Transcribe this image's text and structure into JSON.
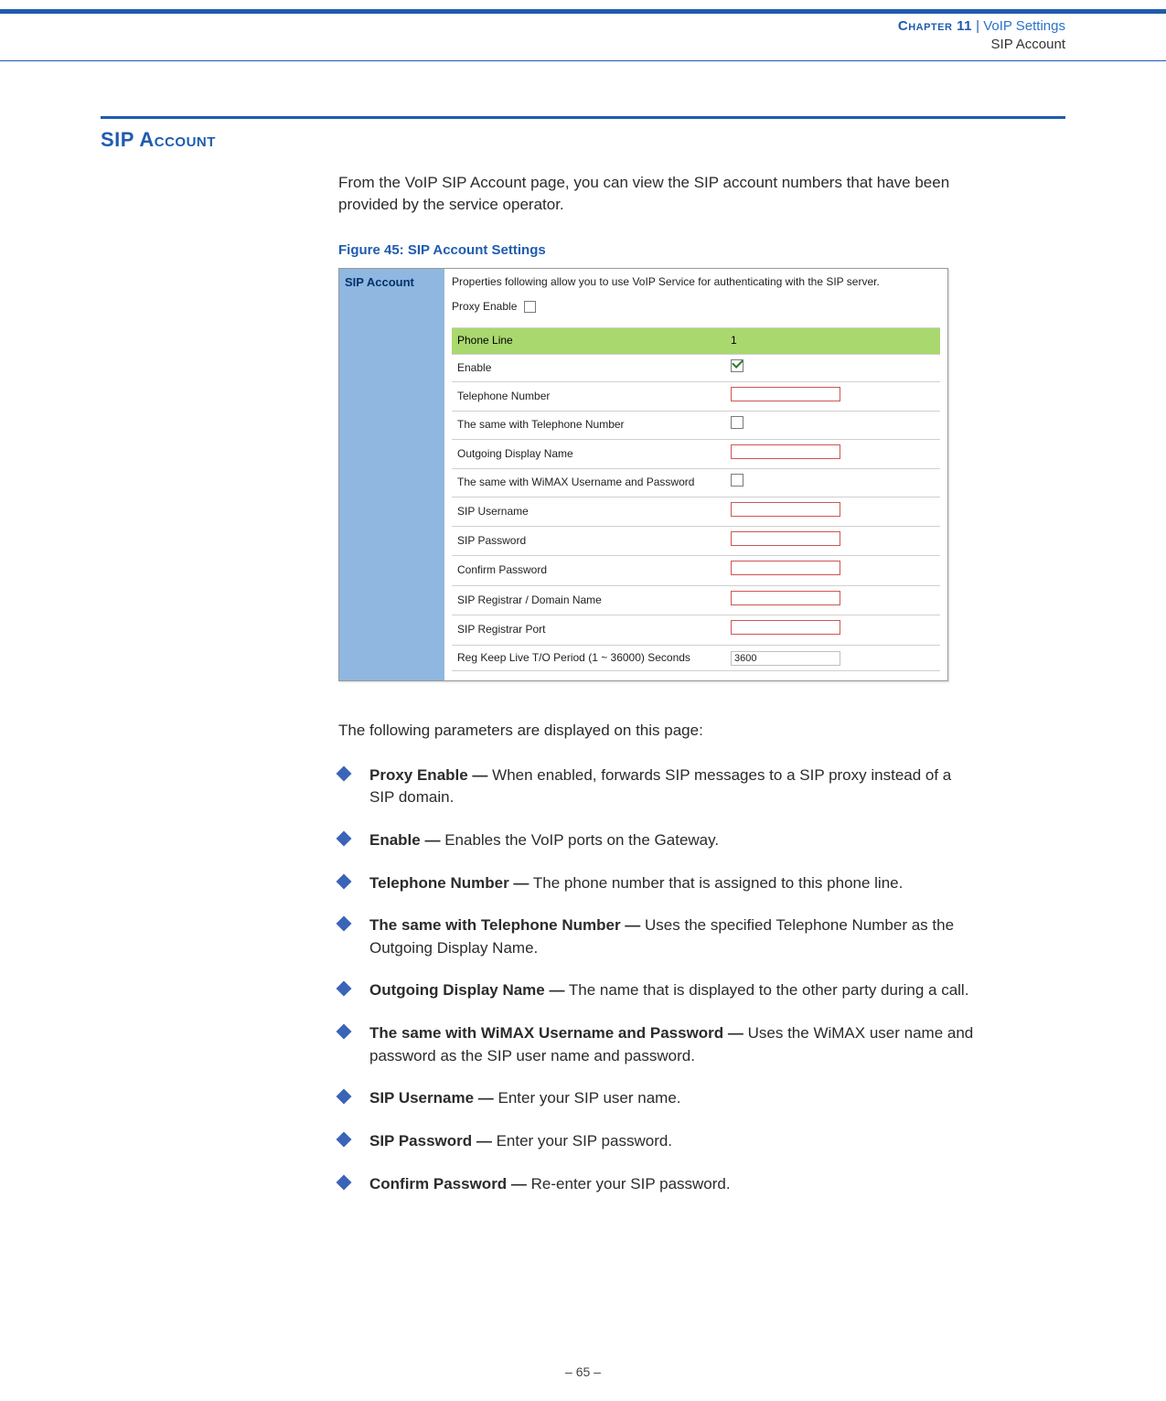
{
  "header": {
    "chapter_label": "Chapter 11",
    "separator": "  |  ",
    "chapter_title": "VoIP Settings",
    "subtitle": "SIP Account"
  },
  "section": {
    "title": "SIP Account",
    "intro": "From the VoIP SIP Account page, you can view the SIP account numbers that have been provided by the service operator."
  },
  "figure": {
    "caption": "Figure 45:  SIP Account Settings",
    "sidebar_title": "SIP Account",
    "description": "Properties following allow you to use VoIP Service for authenticating with the SIP server.",
    "proxy_enable_label": "Proxy Enable",
    "proxy_enable_checked": false,
    "header_row": {
      "label": "Phone Line",
      "value": "1"
    },
    "rows": [
      {
        "label": "Enable",
        "type": "checkbox",
        "checked": true
      },
      {
        "label": "Telephone Number",
        "type": "text",
        "value": "",
        "border": "red"
      },
      {
        "label": "The same with Telephone Number",
        "type": "checkbox",
        "checked": false
      },
      {
        "label": "Outgoing Display Name",
        "type": "text",
        "value": "",
        "border": "red"
      },
      {
        "label": "The same with WiMAX Username and Password",
        "type": "checkbox",
        "checked": false
      },
      {
        "label": "SIP Username",
        "type": "text",
        "value": "",
        "border": "red"
      },
      {
        "label": "SIP Password",
        "type": "text",
        "value": "",
        "border": "red"
      },
      {
        "label": "Confirm Password",
        "type": "text",
        "value": "",
        "border": "red"
      },
      {
        "label": "SIP Registrar / Domain Name",
        "type": "text",
        "value": "",
        "border": "red"
      },
      {
        "label": "SIP Registrar Port",
        "type": "text",
        "value": "",
        "border": "red"
      },
      {
        "label": "Reg Keep Live T/O Period (1 ~ 36000) Seconds",
        "type": "text",
        "value": "3600",
        "border": "grey"
      }
    ]
  },
  "parameters": {
    "lead": "The following parameters are displayed on this page:",
    "items": [
      {
        "term": "Proxy Enable —",
        "desc": " When enabled, forwards SIP messages to a SIP proxy instead of a SIP domain."
      },
      {
        "term": "Enable —",
        "desc": " Enables the VoIP ports on the Gateway."
      },
      {
        "term": "Telephone Number —",
        "desc": " The phone number that is assigned to this phone line."
      },
      {
        "term": "The same with Telephone Number —",
        "desc": " Uses the specified Telephone Number as the Outgoing Display Name."
      },
      {
        "term": "Outgoing Display Name —",
        "desc": " The name that is displayed to the other party during a call."
      },
      {
        "term": "The same with WiMAX Username and Password —",
        "desc": " Uses the WiMAX user name and password as the SIP user name and password."
      },
      {
        "term": "SIP Username —",
        "desc": " Enter your SIP user name."
      },
      {
        "term": "SIP Password —",
        "desc": " Enter your SIP password."
      },
      {
        "term": "Confirm Password —",
        "desc": " Re-enter your SIP password."
      }
    ]
  },
  "footer": {
    "page_number": "–  65  –"
  }
}
